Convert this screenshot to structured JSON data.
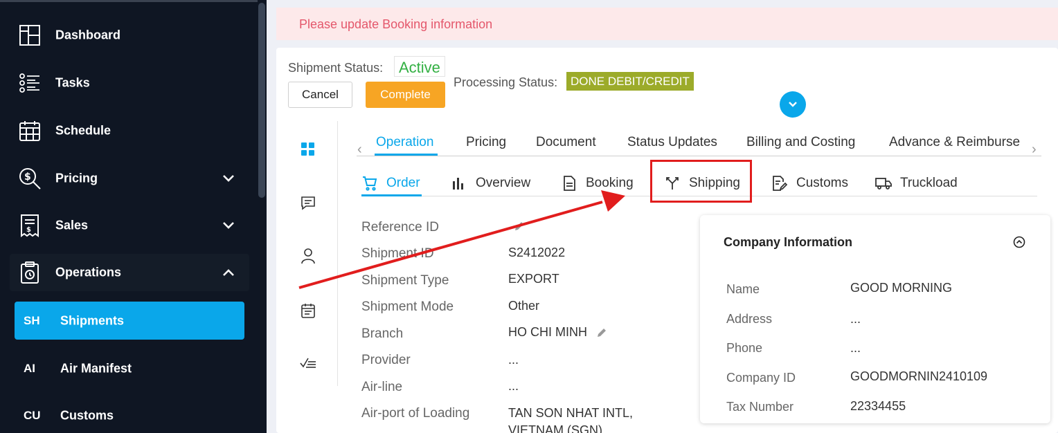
{
  "sidebar": {
    "items": [
      {
        "label": "Dashboard",
        "icon": "dashboard-icon"
      },
      {
        "label": "Tasks",
        "icon": "tasks-icon"
      },
      {
        "label": "Schedule",
        "icon": "calendar-icon"
      },
      {
        "label": "Pricing",
        "icon": "pricing-icon"
      },
      {
        "label": "Sales",
        "icon": "sales-icon"
      },
      {
        "label": "Operations",
        "icon": "operations-icon"
      }
    ],
    "sub_items": [
      {
        "abbr": "SH",
        "label": "Shipments"
      },
      {
        "abbr": "AI",
        "label": "Air Manifest"
      },
      {
        "abbr": "CU",
        "label": "Customs"
      }
    ]
  },
  "alert": {
    "text": "Please update Booking information"
  },
  "status": {
    "shipment_label": "Shipment Status:",
    "shipment_value": "Active",
    "processing_label": "Processing Status:",
    "processing_value": "DONE DEBIT/CREDIT"
  },
  "actions": {
    "cancel": "Cancel",
    "complete": "Complete"
  },
  "tabs": [
    "Operation",
    "Pricing",
    "Document",
    "Status Updates",
    "Billing and Costing",
    "Advance & Reimburse"
  ],
  "subtabs": [
    "Order",
    "Overview",
    "Booking",
    "Shipping",
    "Customs",
    "Truckload"
  ],
  "fields": [
    {
      "label": "Reference ID",
      "value": ""
    },
    {
      "label": "Shipment ID",
      "value": "S2412022"
    },
    {
      "label": "Shipment Type",
      "value": "EXPORT"
    },
    {
      "label": "Shipment Mode",
      "value": "Other"
    },
    {
      "label": "Branch",
      "value": "HO CHI MINH"
    },
    {
      "label": "Provider",
      "value": "..."
    },
    {
      "label": "Air-line",
      "value": "..."
    },
    {
      "label": "Air-port of Loading",
      "value": "TAN SON NHAT INTL,",
      "value2": "VIETNAM (SGN)"
    }
  ],
  "company": {
    "title": "Company Information",
    "rows": [
      {
        "label": "Name",
        "value": "GOOD MORNING"
      },
      {
        "label": "Address",
        "value": "..."
      },
      {
        "label": "Phone",
        "value": "..."
      },
      {
        "label": "Company ID",
        "value": "GOODMORNIN2410109"
      },
      {
        "label": "Tax Number",
        "value": "22334455"
      }
    ]
  },
  "colors": {
    "sidebar_bg": "#0f1623",
    "accent": "#0aa7ea",
    "active_status": "#33b043",
    "processing_badge": "#9cab2a",
    "complete_button": "#f7a524",
    "alert_text": "#e4576b",
    "annotation": "#e11d1d"
  }
}
